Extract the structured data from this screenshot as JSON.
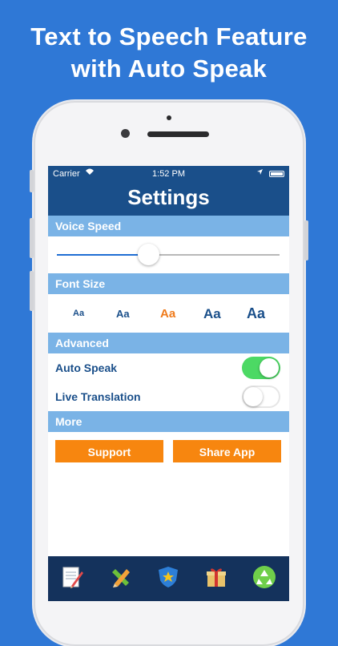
{
  "promo": {
    "line1": "Text to Speech Feature",
    "line2": "with Auto Speak"
  },
  "status_bar": {
    "carrier": "Carrier",
    "time": "1:52 PM"
  },
  "nav": {
    "title": "Settings"
  },
  "voice_speed": {
    "header": "Voice Speed",
    "value_fraction": 0.41
  },
  "font_size": {
    "header": "Font Size",
    "options": [
      "Aa",
      "Aa",
      "Aa",
      "Aa",
      "Aa"
    ],
    "selected_index": 2
  },
  "advanced": {
    "header": "Advanced",
    "auto_speak": {
      "label": "Auto Speak",
      "on": true
    },
    "live_translation": {
      "label": "Live Translation",
      "on": false
    }
  },
  "more": {
    "header": "More",
    "support_label": "Support",
    "share_label": "Share App"
  },
  "tab_bar": {
    "icons": [
      "notepad-icon",
      "pencil-ruler-icon",
      "star-shield-icon",
      "gift-icon",
      "recycle-icon"
    ]
  },
  "colors": {
    "background": "#2f78d6",
    "nav": "#1a4f8a",
    "section": "#7ab3e6",
    "accent_orange": "#f7860f",
    "toggle_on": "#4cd964"
  }
}
